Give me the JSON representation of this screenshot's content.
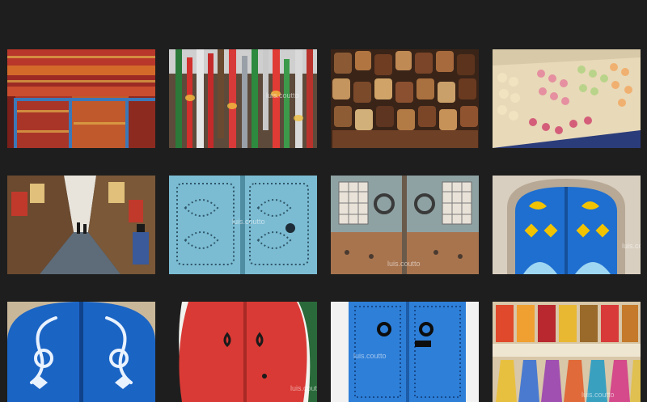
{
  "gallery": {
    "tiles": [
      {
        "subject": "stacked woven carpets",
        "watermark": ""
      },
      {
        "subject": "hanging colorful hookahs",
        "watermark": "luis.coutto"
      },
      {
        "subject": "wall of leather bags",
        "watermark": ""
      },
      {
        "subject": "trays of pastries",
        "watermark": ""
      },
      {
        "subject": "souk alley",
        "watermark": ""
      },
      {
        "subject": "light blue studded door",
        "watermark": "luis.coutto"
      },
      {
        "subject": "weathered door with grilles",
        "watermark": "luis.coutto"
      },
      {
        "subject": "arched blue door with yellow ornaments",
        "watermark": "luis.coutto"
      },
      {
        "subject": "blue arched door with white swirls",
        "watermark": ""
      },
      {
        "subject": "red door with green frame",
        "watermark": "luis.coutto"
      },
      {
        "subject": "blue door with knockers",
        "watermark": "luis.coutto"
      },
      {
        "subject": "shelves of colored glasses",
        "watermark": "luis.coutto"
      }
    ]
  },
  "colors": {
    "background": "#1e1e1e",
    "door_blue": "#1f6fd0",
    "door_light_blue": "#7bbcd3",
    "door_red": "#d93a35",
    "ornament_yellow": "#f2c300"
  }
}
